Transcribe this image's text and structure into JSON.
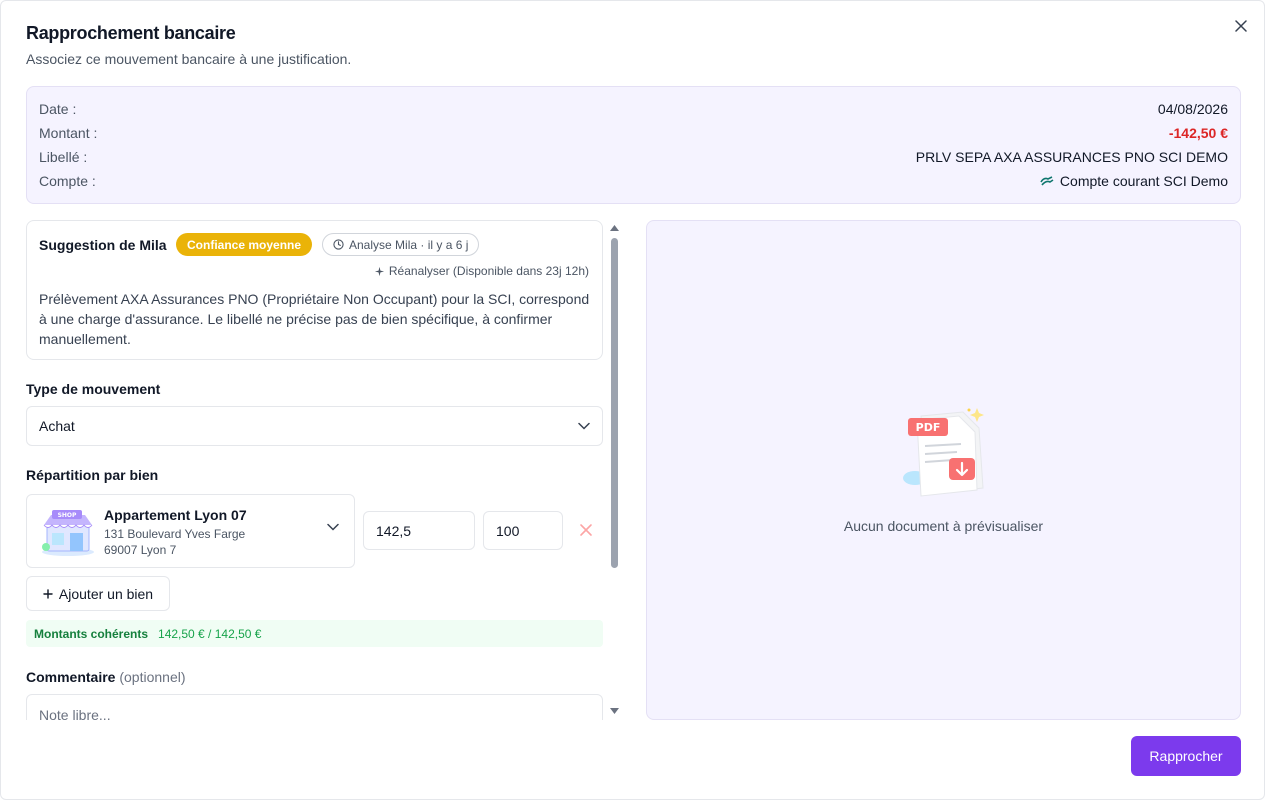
{
  "dialog": {
    "title": "Rapprochement bancaire",
    "subtitle": "Associez ce mouvement bancaire à une justification."
  },
  "transaction": {
    "date_label": "Date :",
    "date_value": "04/08/2026",
    "amount_label": "Montant :",
    "amount_value": "-142,50 €",
    "label_label": "Libellé :",
    "label_value": "PRLV SEPA AXA ASSURANCES PNO SCI DEMO",
    "account_label": "Compte :",
    "account_value": "Compte courant SCI Demo",
    "account_icon": "bank-logo-icon"
  },
  "suggestion": {
    "title": "Suggestion de Mila",
    "confidence_badge": "Confiance moyenne",
    "analysis_badge": "Analyse Mila · il y a 6 j",
    "reanalyse": "Réanalyser (Disponible dans 23j 12h)",
    "text": "Prélèvement AXA Assurances PNO (Propriétaire Non Occupant) pour la SCI, correspond à une charge d'assurance. Le libellé ne précise pas de bien spécifique, à confirmer manuellement."
  },
  "movement_type": {
    "label": "Type de mouvement",
    "selected": "Achat"
  },
  "allocation": {
    "label": "Répartition par bien",
    "property_name": "Appartement Lyon 07",
    "property_address_line1": "131 Boulevard Yves Farge",
    "property_address_line2": "69007 Lyon 7",
    "amount": "142,5",
    "percent": "100",
    "add_button": "Ajouter un bien",
    "coherent_label": "Montants cohérents",
    "coherent_amounts": "142,50 € / 142,50 €"
  },
  "comment": {
    "label": "Commentaire",
    "optional": "(optionnel)",
    "placeholder": "Note libre..."
  },
  "preview": {
    "empty_text": "Aucun document à prévisualiser"
  },
  "actions": {
    "submit": "Rapprocher"
  },
  "colors": {
    "accent": "#7c3aed",
    "negative": "#dc2626",
    "confidence": "#eab308",
    "success": "#15803d"
  }
}
